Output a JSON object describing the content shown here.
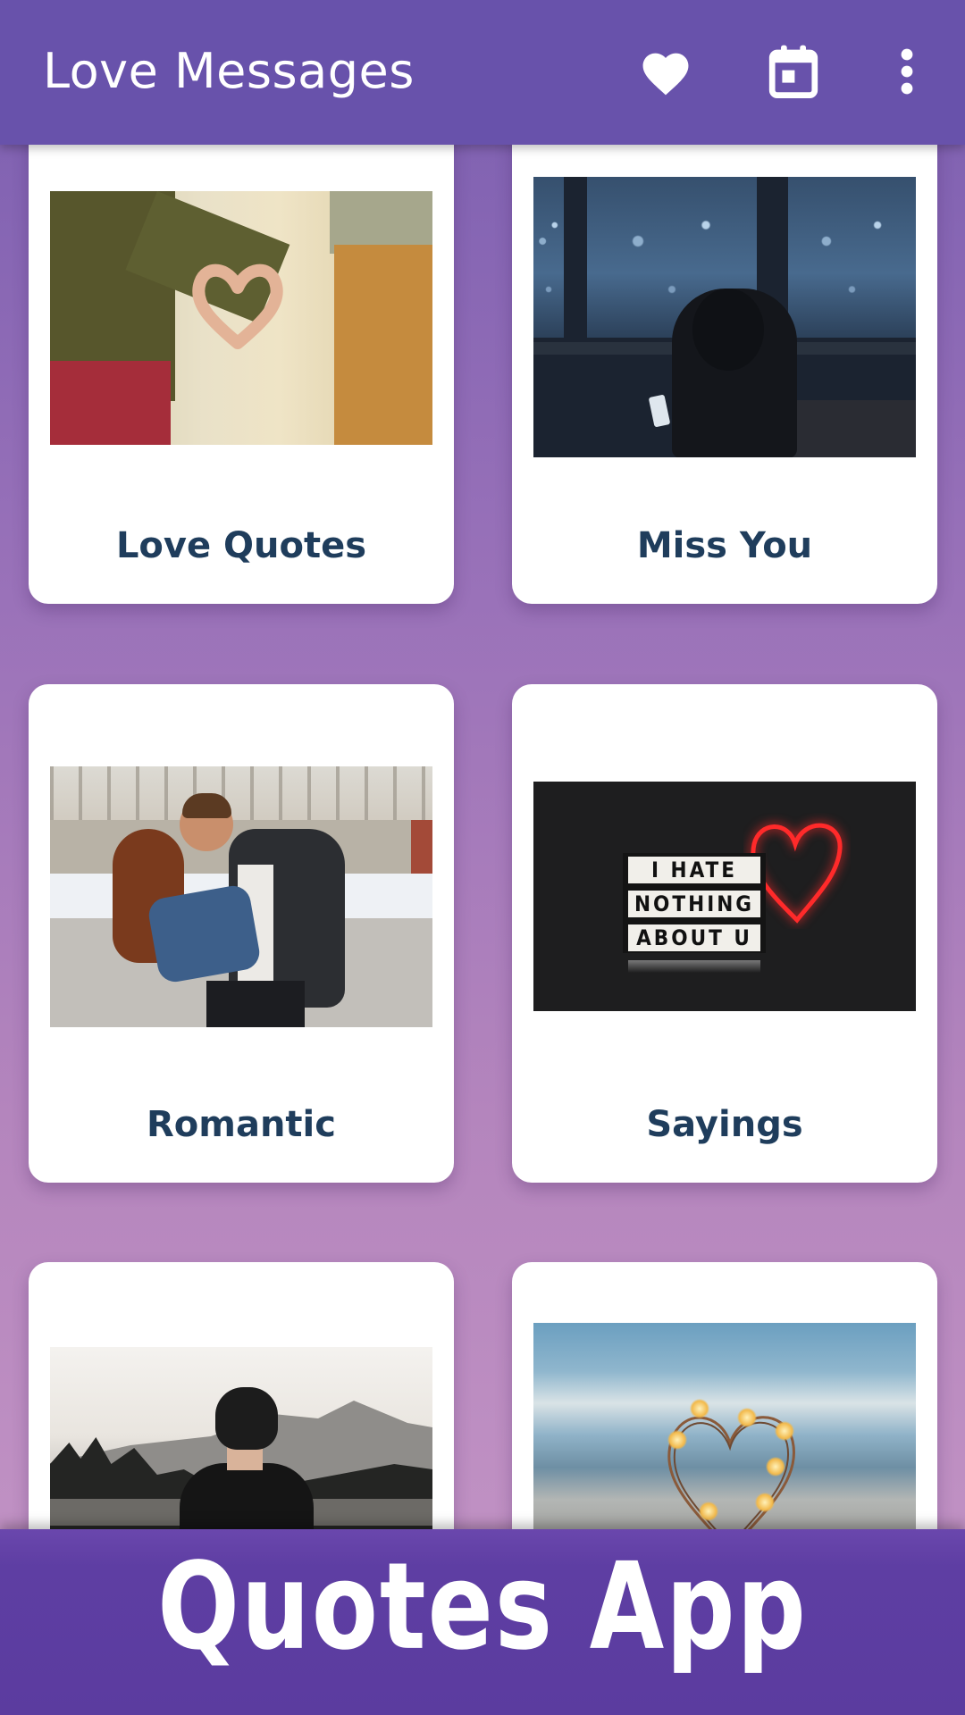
{
  "app_bar": {
    "title": "Love Messages",
    "icons": [
      "heart-icon",
      "calendar-icon",
      "more-vert-icon"
    ]
  },
  "categories": [
    {
      "label": "Love Quotes",
      "image": "hands-heart-photo"
    },
    {
      "label": "Miss You",
      "image": "window-night-photo"
    },
    {
      "label": "Romantic",
      "image": "couple-kiss-photo"
    },
    {
      "label": "Sayings",
      "image": "lightbox-neon-heart-photo"
    },
    {
      "label": "",
      "image": "boy-mountains-photo"
    },
    {
      "label": "",
      "image": "fairy-light-heart-photo"
    }
  ],
  "lightbox_text": [
    "I HATE",
    "NOTHING",
    "ABOUT U"
  ],
  "banner": {
    "title": "Quotes App"
  },
  "colors": {
    "app_bar": "#6852ab",
    "banner": "#5b3c9f",
    "card_label": "#1f3d5c",
    "card": "#ffffff"
  }
}
